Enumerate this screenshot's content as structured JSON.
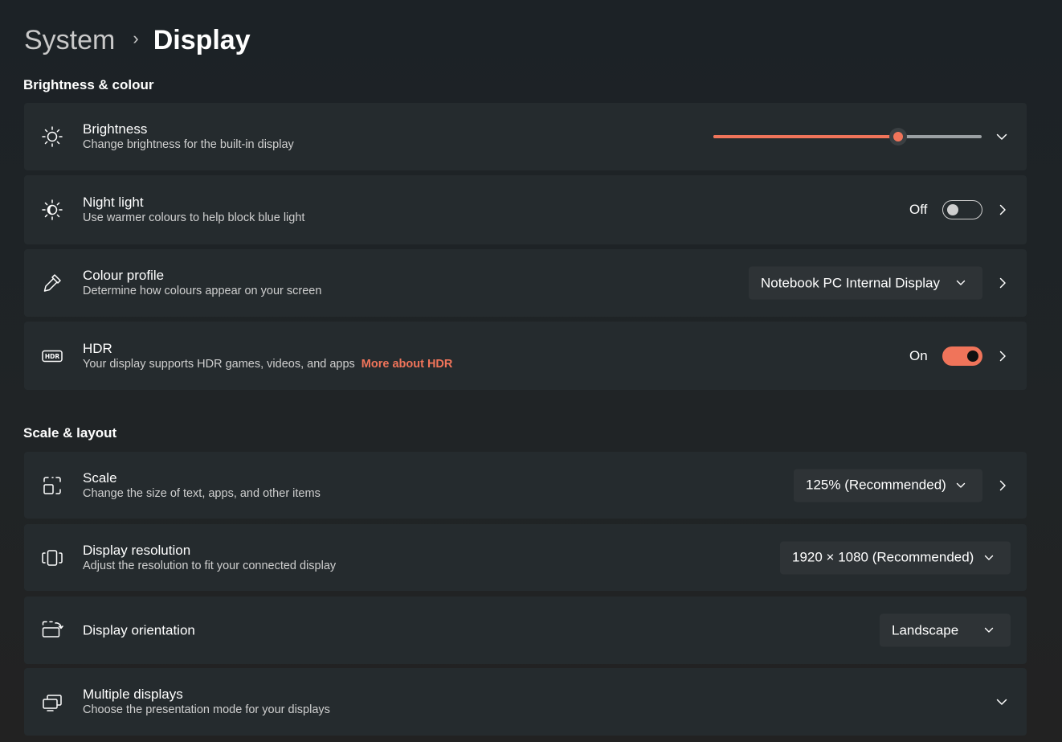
{
  "breadcrumb": {
    "parent": "System",
    "separator": "›",
    "current": "Display"
  },
  "sections": {
    "brightness": "Brightness & colour",
    "scale": "Scale & layout"
  },
  "cards": {
    "brightness": {
      "title": "Brightness",
      "desc": "Change brightness for the built-in display",
      "level": 0.69,
      "icon": "sun-icon"
    },
    "night_light": {
      "title": "Night light",
      "desc": "Use warmer colours to help block blue light",
      "state": "Off",
      "icon": "night-light-icon"
    },
    "colour_profile": {
      "title": "Colour profile",
      "desc": "Determine how colours appear on your screen",
      "value": "Notebook PC Internal Display",
      "icon": "eyedropper-icon"
    },
    "hdr": {
      "title": "HDR",
      "desc": "Your display supports HDR games, videos, and apps",
      "link": "More about HDR",
      "state": "On",
      "icon": "hdr-icon"
    },
    "scale": {
      "title": "Scale",
      "desc": "Change the size of text, apps, and other items",
      "value": "125% (Recommended)",
      "icon": "scale-icon"
    },
    "resolution": {
      "title": "Display resolution",
      "desc": "Adjust the resolution to fit your connected display",
      "value": "1920 × 1080 (Recommended)",
      "icon": "resolution-icon"
    },
    "orientation": {
      "title": "Display orientation",
      "value": "Landscape",
      "icon": "orientation-icon"
    },
    "multiple": {
      "title": "Multiple displays",
      "desc": "Choose the presentation mode for your displays",
      "icon": "multiple-displays-icon"
    }
  },
  "colors": {
    "accent": "#f0745a",
    "card": "#252b2e",
    "dropdown": "#2e3336"
  }
}
